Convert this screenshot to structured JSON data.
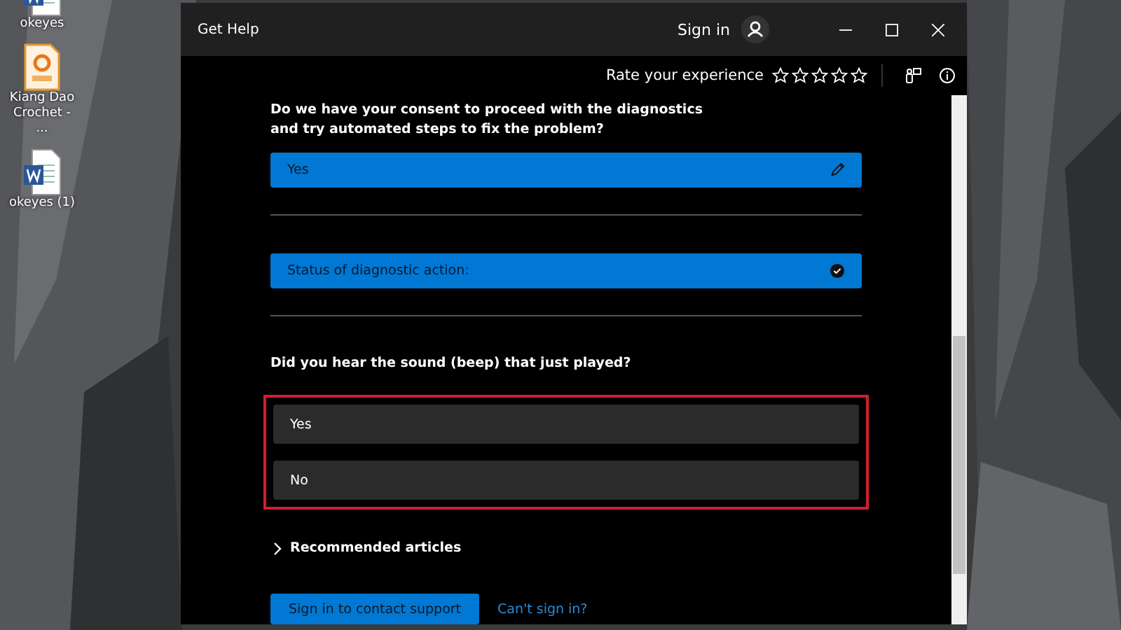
{
  "desktop": {
    "icons": [
      {
        "kind": "word",
        "label": "okeyes"
      },
      {
        "kind": "pdf",
        "label": "Kiang Dao Crochet - ..."
      },
      {
        "kind": "word",
        "label": "okeyes (1)"
      }
    ]
  },
  "window": {
    "title": "Get Help",
    "sign_in": "Sign in",
    "rating": {
      "label": "Rate your experience",
      "stars": 0
    }
  },
  "conversation": [
    {
      "kind": "question",
      "text": "Do we have your consent to proceed with the diagnostics and try automated steps to fix the problem?"
    },
    {
      "kind": "answer",
      "text": "Yes"
    },
    {
      "kind": "divider"
    },
    {
      "kind": "status",
      "text": "Status of diagnostic action:"
    },
    {
      "kind": "divider"
    },
    {
      "kind": "question",
      "text": "Did you hear the sound (beep) that just played?"
    },
    {
      "kind": "options",
      "highlighted": true,
      "options": [
        "Yes",
        "No"
      ]
    }
  ],
  "recommended": {
    "label": "Recommended articles",
    "expanded": false
  },
  "footer": {
    "button": "Sign in to contact support",
    "link": "Can't sign in?"
  }
}
